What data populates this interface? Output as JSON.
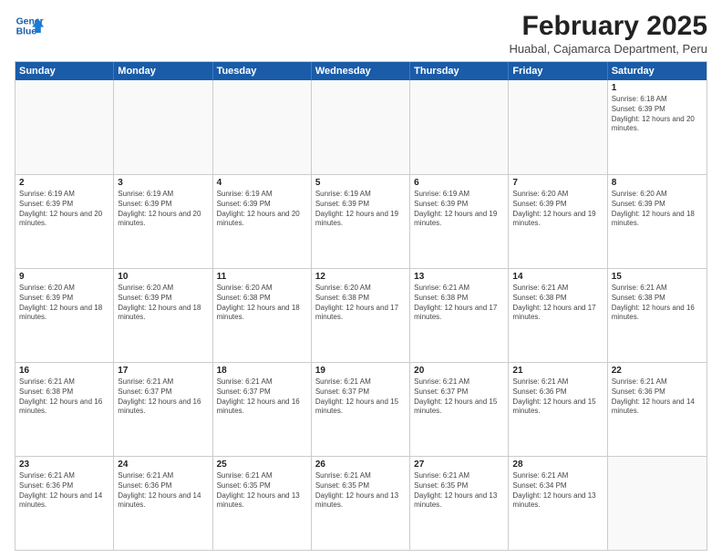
{
  "header": {
    "logo_line1": "General",
    "logo_line2": "Blue",
    "month_title": "February 2025",
    "location": "Huabal, Cajamarca Department, Peru"
  },
  "weekdays": [
    "Sunday",
    "Monday",
    "Tuesday",
    "Wednesday",
    "Thursday",
    "Friday",
    "Saturday"
  ],
  "rows": [
    [
      {
        "day": "",
        "info": ""
      },
      {
        "day": "",
        "info": ""
      },
      {
        "day": "",
        "info": ""
      },
      {
        "day": "",
        "info": ""
      },
      {
        "day": "",
        "info": ""
      },
      {
        "day": "",
        "info": ""
      },
      {
        "day": "1",
        "info": "Sunrise: 6:18 AM\nSunset: 6:39 PM\nDaylight: 12 hours and 20 minutes."
      }
    ],
    [
      {
        "day": "2",
        "info": "Sunrise: 6:19 AM\nSunset: 6:39 PM\nDaylight: 12 hours and 20 minutes."
      },
      {
        "day": "3",
        "info": "Sunrise: 6:19 AM\nSunset: 6:39 PM\nDaylight: 12 hours and 20 minutes."
      },
      {
        "day": "4",
        "info": "Sunrise: 6:19 AM\nSunset: 6:39 PM\nDaylight: 12 hours and 20 minutes."
      },
      {
        "day": "5",
        "info": "Sunrise: 6:19 AM\nSunset: 6:39 PM\nDaylight: 12 hours and 19 minutes."
      },
      {
        "day": "6",
        "info": "Sunrise: 6:19 AM\nSunset: 6:39 PM\nDaylight: 12 hours and 19 minutes."
      },
      {
        "day": "7",
        "info": "Sunrise: 6:20 AM\nSunset: 6:39 PM\nDaylight: 12 hours and 19 minutes."
      },
      {
        "day": "8",
        "info": "Sunrise: 6:20 AM\nSunset: 6:39 PM\nDaylight: 12 hours and 18 minutes."
      }
    ],
    [
      {
        "day": "9",
        "info": "Sunrise: 6:20 AM\nSunset: 6:39 PM\nDaylight: 12 hours and 18 minutes."
      },
      {
        "day": "10",
        "info": "Sunrise: 6:20 AM\nSunset: 6:39 PM\nDaylight: 12 hours and 18 minutes."
      },
      {
        "day": "11",
        "info": "Sunrise: 6:20 AM\nSunset: 6:38 PM\nDaylight: 12 hours and 18 minutes."
      },
      {
        "day": "12",
        "info": "Sunrise: 6:20 AM\nSunset: 6:38 PM\nDaylight: 12 hours and 17 minutes."
      },
      {
        "day": "13",
        "info": "Sunrise: 6:21 AM\nSunset: 6:38 PM\nDaylight: 12 hours and 17 minutes."
      },
      {
        "day": "14",
        "info": "Sunrise: 6:21 AM\nSunset: 6:38 PM\nDaylight: 12 hours and 17 minutes."
      },
      {
        "day": "15",
        "info": "Sunrise: 6:21 AM\nSunset: 6:38 PM\nDaylight: 12 hours and 16 minutes."
      }
    ],
    [
      {
        "day": "16",
        "info": "Sunrise: 6:21 AM\nSunset: 6:38 PM\nDaylight: 12 hours and 16 minutes."
      },
      {
        "day": "17",
        "info": "Sunrise: 6:21 AM\nSunset: 6:37 PM\nDaylight: 12 hours and 16 minutes."
      },
      {
        "day": "18",
        "info": "Sunrise: 6:21 AM\nSunset: 6:37 PM\nDaylight: 12 hours and 16 minutes."
      },
      {
        "day": "19",
        "info": "Sunrise: 6:21 AM\nSunset: 6:37 PM\nDaylight: 12 hours and 15 minutes."
      },
      {
        "day": "20",
        "info": "Sunrise: 6:21 AM\nSunset: 6:37 PM\nDaylight: 12 hours and 15 minutes."
      },
      {
        "day": "21",
        "info": "Sunrise: 6:21 AM\nSunset: 6:36 PM\nDaylight: 12 hours and 15 minutes."
      },
      {
        "day": "22",
        "info": "Sunrise: 6:21 AM\nSunset: 6:36 PM\nDaylight: 12 hours and 14 minutes."
      }
    ],
    [
      {
        "day": "23",
        "info": "Sunrise: 6:21 AM\nSunset: 6:36 PM\nDaylight: 12 hours and 14 minutes."
      },
      {
        "day": "24",
        "info": "Sunrise: 6:21 AM\nSunset: 6:36 PM\nDaylight: 12 hours and 14 minutes."
      },
      {
        "day": "25",
        "info": "Sunrise: 6:21 AM\nSunset: 6:35 PM\nDaylight: 12 hours and 13 minutes."
      },
      {
        "day": "26",
        "info": "Sunrise: 6:21 AM\nSunset: 6:35 PM\nDaylight: 12 hours and 13 minutes."
      },
      {
        "day": "27",
        "info": "Sunrise: 6:21 AM\nSunset: 6:35 PM\nDaylight: 12 hours and 13 minutes."
      },
      {
        "day": "28",
        "info": "Sunrise: 6:21 AM\nSunset: 6:34 PM\nDaylight: 12 hours and 13 minutes."
      },
      {
        "day": "",
        "info": ""
      }
    ]
  ]
}
